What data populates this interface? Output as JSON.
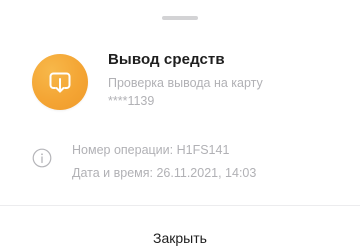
{
  "operation": {
    "title": "Вывод средств",
    "description": "Проверка вывода на карту ****1139",
    "icon": "withdraw-icon",
    "icon_color": "#F4A534"
  },
  "details": {
    "icon": "info-icon",
    "operation_number": "Номер операции: H1FS141",
    "datetime": "Дата и время: 26.11.2021, 14:03"
  },
  "actions": {
    "close_label": "Закрыть"
  }
}
